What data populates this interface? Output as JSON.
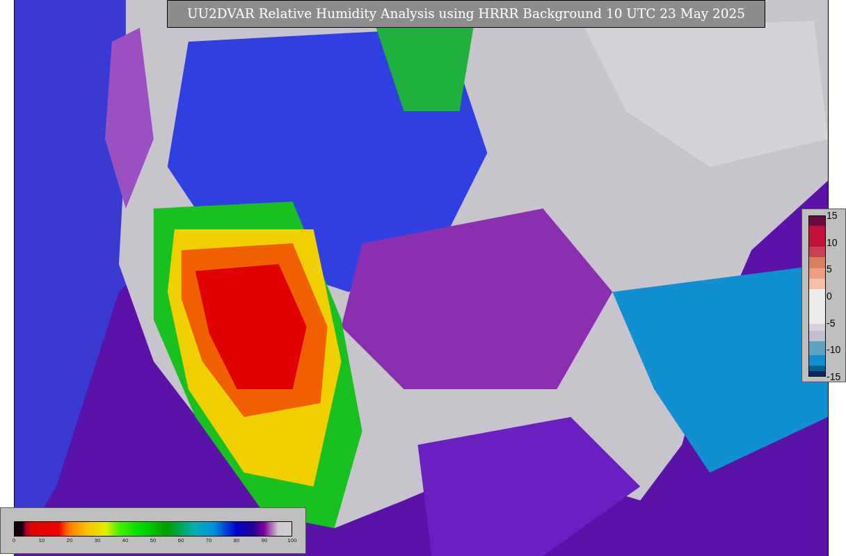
{
  "title": "UU2DVAR Relative Humidity Analysis using HRRR Background 10 UTC 23 May 2025",
  "humidity_colorbar": {
    "ticks": [
      "0",
      "10",
      "20",
      "30",
      "40",
      "50",
      "60",
      "70",
      "80",
      "90",
      "100"
    ]
  },
  "difference_colorbar": {
    "ticks": [
      "15",
      "10",
      "5",
      "0",
      "-5",
      "-10",
      "-15"
    ]
  }
}
